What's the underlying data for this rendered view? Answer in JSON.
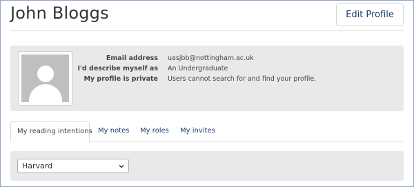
{
  "header": {
    "title": "John Bloggs",
    "edit_label": "Edit Profile"
  },
  "profile": {
    "avatar_icon": "default-user-avatar-icon",
    "rows": [
      {
        "label": "Email address",
        "value": "uasjbb@nottingham.ac.uk"
      },
      {
        "label": "I'd describe myself as",
        "value": "An Undergraduate"
      },
      {
        "label": "My profile is private",
        "value": "Users cannot search for and find your profile."
      }
    ]
  },
  "tabs": [
    {
      "label": "My reading intentions",
      "active": true
    },
    {
      "label": "My notes",
      "active": false
    },
    {
      "label": "My roles",
      "active": false
    },
    {
      "label": "My invites",
      "active": false
    }
  ],
  "filter": {
    "selected": "Harvard",
    "chevron_icon": "chevron-down-icon"
  },
  "colors": {
    "link": "#1c3d6b",
    "panel": "#e9e9e9",
    "frame_border": "#8ea6c4"
  }
}
